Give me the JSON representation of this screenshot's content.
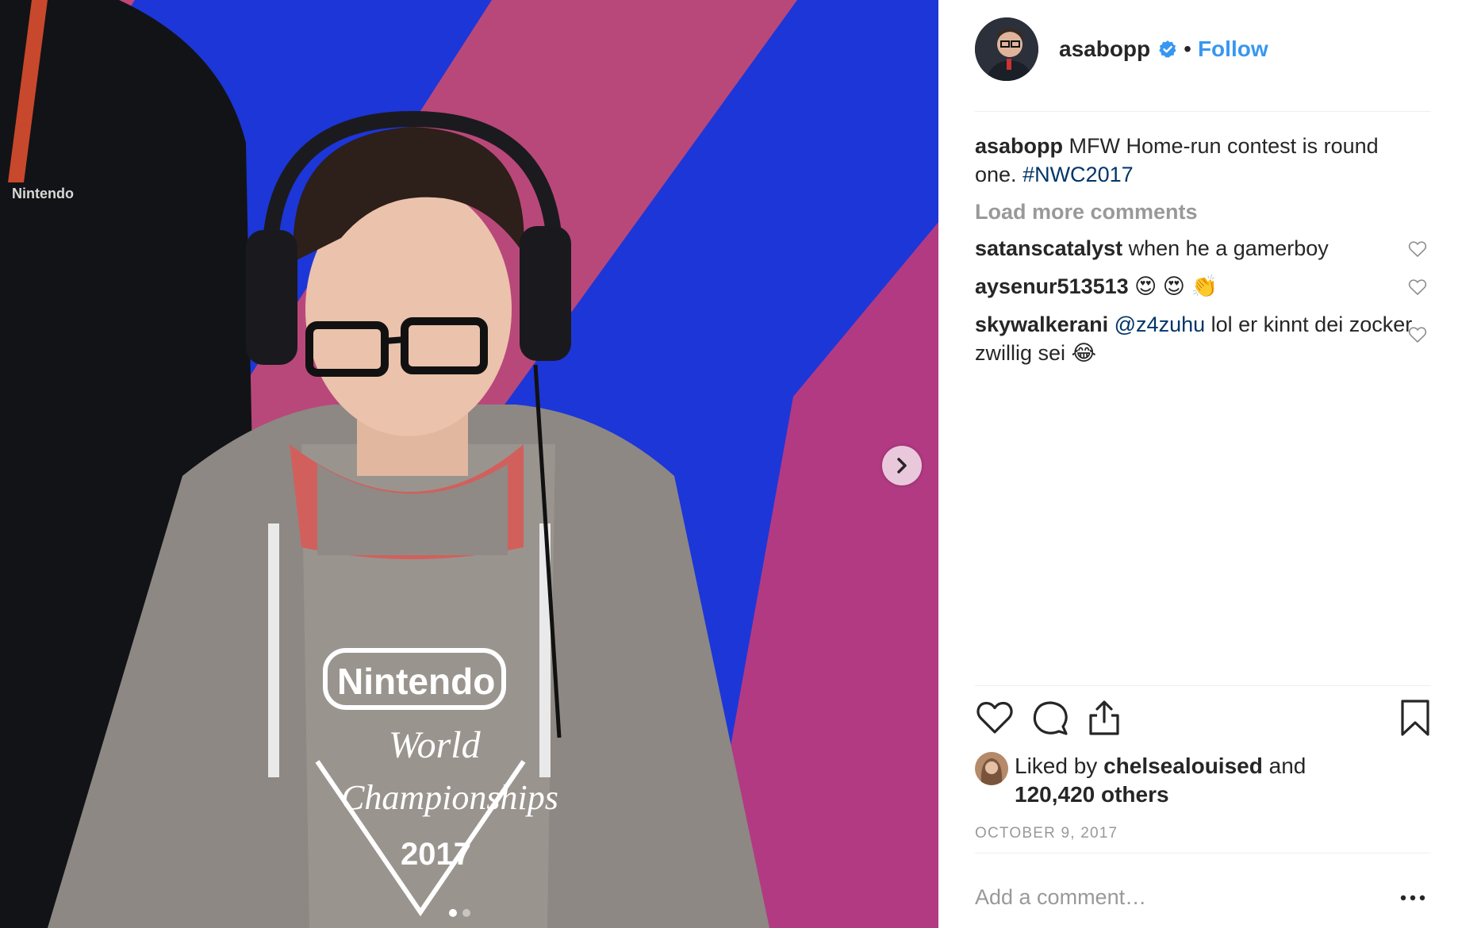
{
  "post": {
    "username": "asabopp",
    "follow_label": "Follow",
    "separator": "•",
    "caption_text": " MFW Home-run contest is round one. ",
    "caption_hashtag": "#NWC2017",
    "load_more": "Load more comments",
    "comments": [
      {
        "user": "satanscatalyst",
        "text": " when he a gamerboy"
      },
      {
        "user": "aysenur513513",
        "text": " 😍 😍 👏"
      },
      {
        "user": "skywalkerani",
        "mention": "@z4zuhu",
        "text": " lol er kinnt dei zocker zwillig sei 😂"
      }
    ],
    "likes": {
      "prefix": "Liked by ",
      "liker": "chelsealouised",
      "middle": " and ",
      "others": "120,420 others"
    },
    "date": "OCTOBER 9, 2017",
    "add_comment_placeholder": "Add a comment…"
  },
  "media": {
    "shirt_brand": "Nintendo",
    "shirt_line1": "World",
    "shirt_line2": "Championships",
    "shirt_year": "2017",
    "carousel_total": 2,
    "carousel_active": 1
  },
  "icons": {
    "verified": "verified-badge-icon",
    "like": "heart-icon",
    "comment": "comment-bubble-icon",
    "share": "share-icon",
    "save": "bookmark-icon",
    "next": "chevron-right-icon",
    "more": "more-options-icon"
  },
  "colors": {
    "follow": "#3897f0",
    "link": "#003569",
    "muted": "#999999",
    "text": "#262626",
    "verified": "#3897f0"
  }
}
